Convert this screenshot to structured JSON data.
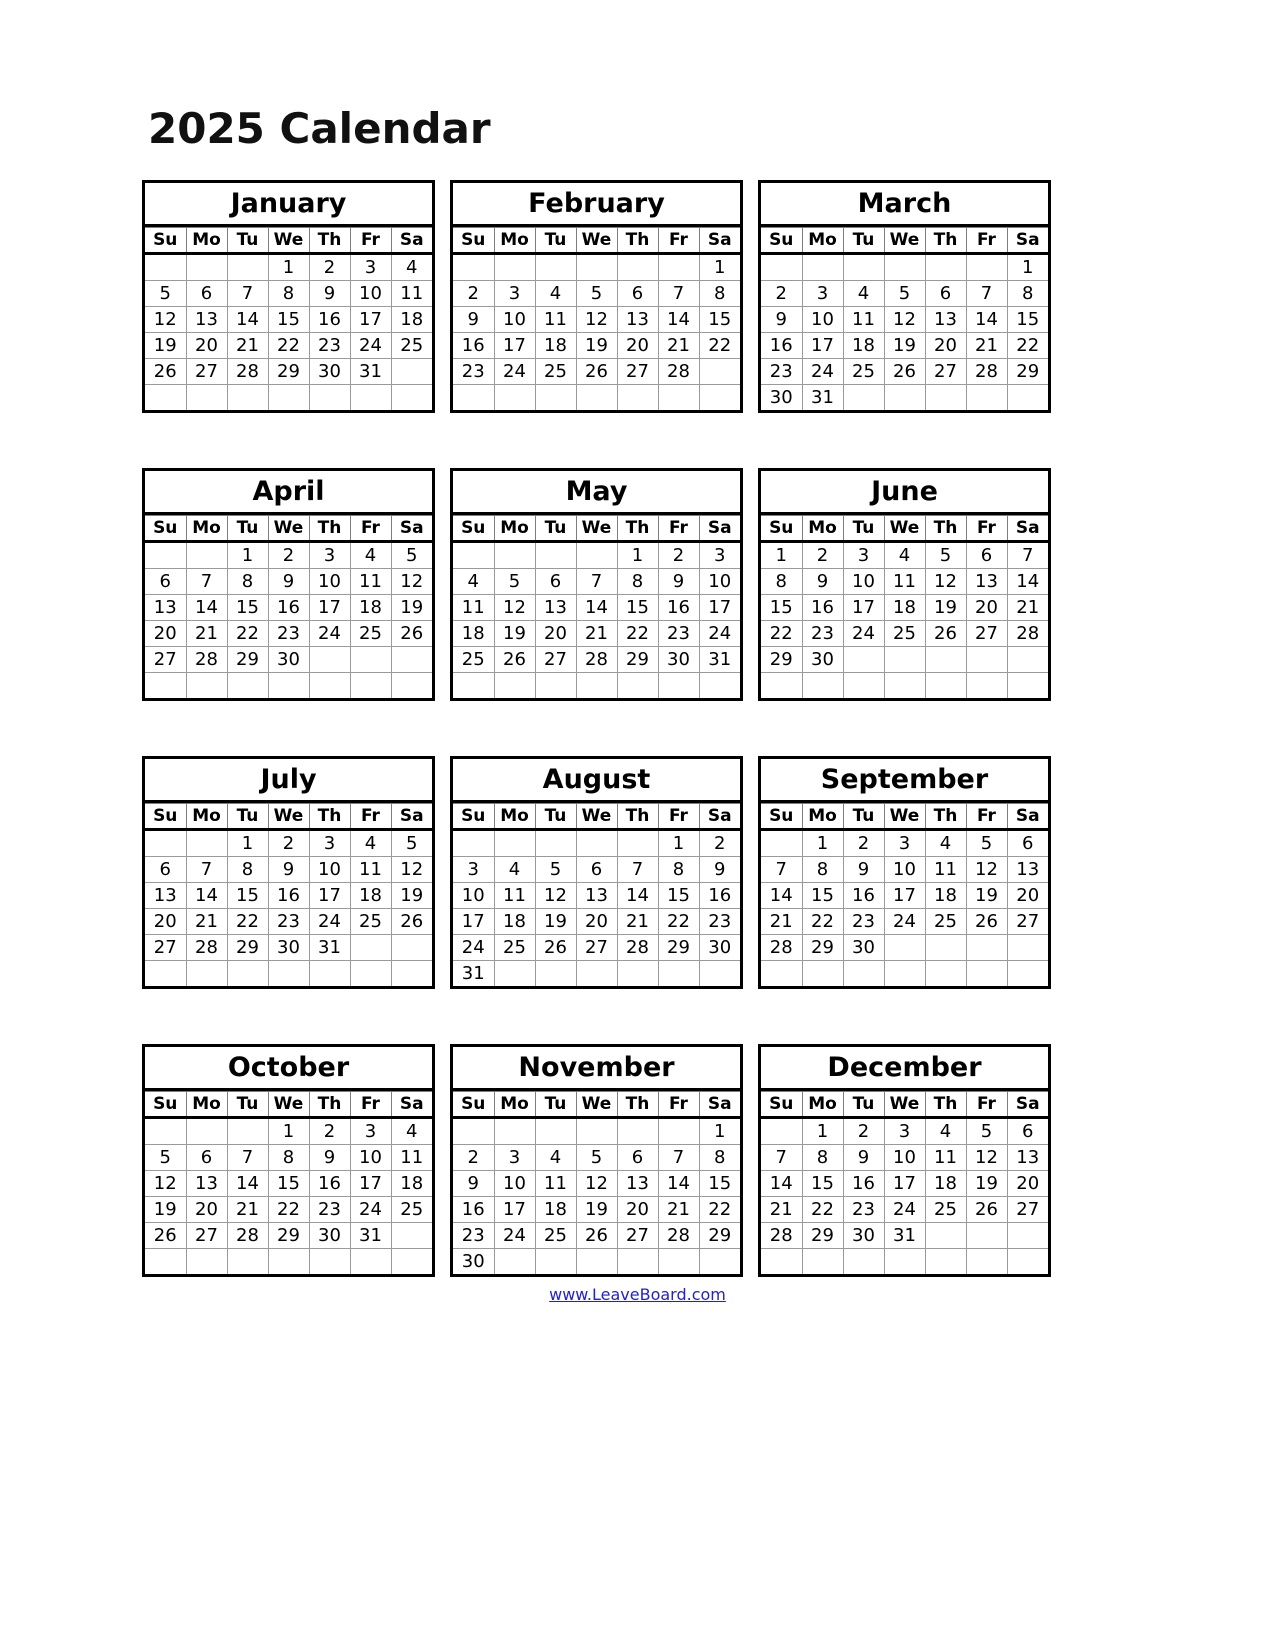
{
  "document": {
    "title": "2025 Calendar",
    "year": 2025,
    "footer_link_text": "www.LeaveBoard.com",
    "link_color": "#2222cc",
    "border_color": "#000000",
    "background_color": "#ffffff"
  },
  "weekday_headers": [
    "Su",
    "Mo",
    "Tu",
    "We",
    "Th",
    "Fr",
    "Sa"
  ],
  "months": [
    {
      "name": "January",
      "index": 1,
      "start_weekday": "We",
      "days_in_month": 31,
      "weeks": [
        [
          "",
          "",
          "",
          "1",
          "2",
          "3",
          "4"
        ],
        [
          "5",
          "6",
          "7",
          "8",
          "9",
          "10",
          "11"
        ],
        [
          "12",
          "13",
          "14",
          "15",
          "16",
          "17",
          "18"
        ],
        [
          "19",
          "20",
          "21",
          "22",
          "23",
          "24",
          "25"
        ],
        [
          "26",
          "27",
          "28",
          "29",
          "30",
          "31",
          ""
        ],
        [
          "",
          "",
          "",
          "",
          "",
          "",
          ""
        ]
      ]
    },
    {
      "name": "February",
      "index": 2,
      "start_weekday": "Sa",
      "days_in_month": 28,
      "weeks": [
        [
          "",
          "",
          "",
          "",
          "",
          "",
          "1"
        ],
        [
          "2",
          "3",
          "4",
          "5",
          "6",
          "7",
          "8"
        ],
        [
          "9",
          "10",
          "11",
          "12",
          "13",
          "14",
          "15"
        ],
        [
          "16",
          "17",
          "18",
          "19",
          "20",
          "21",
          "22"
        ],
        [
          "23",
          "24",
          "25",
          "26",
          "27",
          "28",
          ""
        ],
        [
          "",
          "",
          "",
          "",
          "",
          "",
          ""
        ]
      ]
    },
    {
      "name": "March",
      "index": 3,
      "start_weekday": "Sa",
      "days_in_month": 31,
      "weeks": [
        [
          "",
          "",
          "",
          "",
          "",
          "",
          "1"
        ],
        [
          "2",
          "3",
          "4",
          "5",
          "6",
          "7",
          "8"
        ],
        [
          "9",
          "10",
          "11",
          "12",
          "13",
          "14",
          "15"
        ],
        [
          "16",
          "17",
          "18",
          "19",
          "20",
          "21",
          "22"
        ],
        [
          "23",
          "24",
          "25",
          "26",
          "27",
          "28",
          "29"
        ],
        [
          "30",
          "31",
          "",
          "",
          "",
          "",
          ""
        ]
      ]
    },
    {
      "name": "April",
      "index": 4,
      "start_weekday": "Tu",
      "days_in_month": 30,
      "weeks": [
        [
          "",
          "",
          "1",
          "2",
          "3",
          "4",
          "5"
        ],
        [
          "6",
          "7",
          "8",
          "9",
          "10",
          "11",
          "12"
        ],
        [
          "13",
          "14",
          "15",
          "16",
          "17",
          "18",
          "19"
        ],
        [
          "20",
          "21",
          "22",
          "23",
          "24",
          "25",
          "26"
        ],
        [
          "27",
          "28",
          "29",
          "30",
          "",
          "",
          ""
        ],
        [
          "",
          "",
          "",
          "",
          "",
          "",
          ""
        ]
      ]
    },
    {
      "name": "May",
      "index": 5,
      "start_weekday": "Th",
      "days_in_month": 31,
      "weeks": [
        [
          "",
          "",
          "",
          "",
          "1",
          "2",
          "3"
        ],
        [
          "4",
          "5",
          "6",
          "7",
          "8",
          "9",
          "10"
        ],
        [
          "11",
          "12",
          "13",
          "14",
          "15",
          "16",
          "17"
        ],
        [
          "18",
          "19",
          "20",
          "21",
          "22",
          "23",
          "24"
        ],
        [
          "25",
          "26",
          "27",
          "28",
          "29",
          "30",
          "31"
        ],
        [
          "",
          "",
          "",
          "",
          "",
          "",
          ""
        ]
      ]
    },
    {
      "name": "June",
      "index": 6,
      "start_weekday": "Su",
      "days_in_month": 30,
      "weeks": [
        [
          "1",
          "2",
          "3",
          "4",
          "5",
          "6",
          "7"
        ],
        [
          "8",
          "9",
          "10",
          "11",
          "12",
          "13",
          "14"
        ],
        [
          "15",
          "16",
          "17",
          "18",
          "19",
          "20",
          "21"
        ],
        [
          "22",
          "23",
          "24",
          "25",
          "26",
          "27",
          "28"
        ],
        [
          "29",
          "30",
          "",
          "",
          "",
          "",
          ""
        ],
        [
          "",
          "",
          "",
          "",
          "",
          "",
          ""
        ]
      ]
    },
    {
      "name": "July",
      "index": 7,
      "start_weekday": "Tu",
      "days_in_month": 31,
      "weeks": [
        [
          "",
          "",
          "1",
          "2",
          "3",
          "4",
          "5"
        ],
        [
          "6",
          "7",
          "8",
          "9",
          "10",
          "11",
          "12"
        ],
        [
          "13",
          "14",
          "15",
          "16",
          "17",
          "18",
          "19"
        ],
        [
          "20",
          "21",
          "22",
          "23",
          "24",
          "25",
          "26"
        ],
        [
          "27",
          "28",
          "29",
          "30",
          "31",
          "",
          ""
        ],
        [
          "",
          "",
          "",
          "",
          "",
          "",
          ""
        ]
      ]
    },
    {
      "name": "August",
      "index": 8,
      "start_weekday": "Fr",
      "days_in_month": 31,
      "weeks": [
        [
          "",
          "",
          "",
          "",
          "",
          "1",
          "2"
        ],
        [
          "3",
          "4",
          "5",
          "6",
          "7",
          "8",
          "9"
        ],
        [
          "10",
          "11",
          "12",
          "13",
          "14",
          "15",
          "16"
        ],
        [
          "17",
          "18",
          "19",
          "20",
          "21",
          "22",
          "23"
        ],
        [
          "24",
          "25",
          "26",
          "27",
          "28",
          "29",
          "30"
        ],
        [
          "31",
          "",
          "",
          "",
          "",
          "",
          ""
        ]
      ]
    },
    {
      "name": "September",
      "index": 9,
      "start_weekday": "Mo",
      "days_in_month": 30,
      "weeks": [
        [
          "",
          "1",
          "2",
          "3",
          "4",
          "5",
          "6"
        ],
        [
          "7",
          "8",
          "9",
          "10",
          "11",
          "12",
          "13"
        ],
        [
          "14",
          "15",
          "16",
          "17",
          "18",
          "19",
          "20"
        ],
        [
          "21",
          "22",
          "23",
          "24",
          "25",
          "26",
          "27"
        ],
        [
          "28",
          "29",
          "30",
          "",
          "",
          "",
          ""
        ],
        [
          "",
          "",
          "",
          "",
          "",
          "",
          ""
        ]
      ]
    },
    {
      "name": "October",
      "index": 10,
      "start_weekday": "We",
      "days_in_month": 31,
      "weeks": [
        [
          "",
          "",
          "",
          "1",
          "2",
          "3",
          "4"
        ],
        [
          "5",
          "6",
          "7",
          "8",
          "9",
          "10",
          "11"
        ],
        [
          "12",
          "13",
          "14",
          "15",
          "16",
          "17",
          "18"
        ],
        [
          "19",
          "20",
          "21",
          "22",
          "23",
          "24",
          "25"
        ],
        [
          "26",
          "27",
          "28",
          "29",
          "30",
          "31",
          ""
        ],
        [
          "",
          "",
          "",
          "",
          "",
          "",
          ""
        ]
      ]
    },
    {
      "name": "November",
      "index": 11,
      "start_weekday": "Sa",
      "days_in_month": 30,
      "weeks": [
        [
          "",
          "",
          "",
          "",
          "",
          "",
          "1"
        ],
        [
          "2",
          "3",
          "4",
          "5",
          "6",
          "7",
          "8"
        ],
        [
          "9",
          "10",
          "11",
          "12",
          "13",
          "14",
          "15"
        ],
        [
          "16",
          "17",
          "18",
          "19",
          "20",
          "21",
          "22"
        ],
        [
          "23",
          "24",
          "25",
          "26",
          "27",
          "28",
          "29"
        ],
        [
          "30",
          "",
          "",
          "",
          "",
          "",
          ""
        ]
      ]
    },
    {
      "name": "December",
      "index": 12,
      "start_weekday": "Mo",
      "days_in_month": 31,
      "weeks": [
        [
          "",
          "1",
          "2",
          "3",
          "4",
          "5",
          "6"
        ],
        [
          "7",
          "8",
          "9",
          "10",
          "11",
          "12",
          "13"
        ],
        [
          "14",
          "15",
          "16",
          "17",
          "18",
          "19",
          "20"
        ],
        [
          "21",
          "22",
          "23",
          "24",
          "25",
          "26",
          "27"
        ],
        [
          "28",
          "29",
          "30",
          "31",
          "",
          "",
          ""
        ],
        [
          "",
          "",
          "",
          "",
          "",
          "",
          ""
        ]
      ]
    }
  ]
}
